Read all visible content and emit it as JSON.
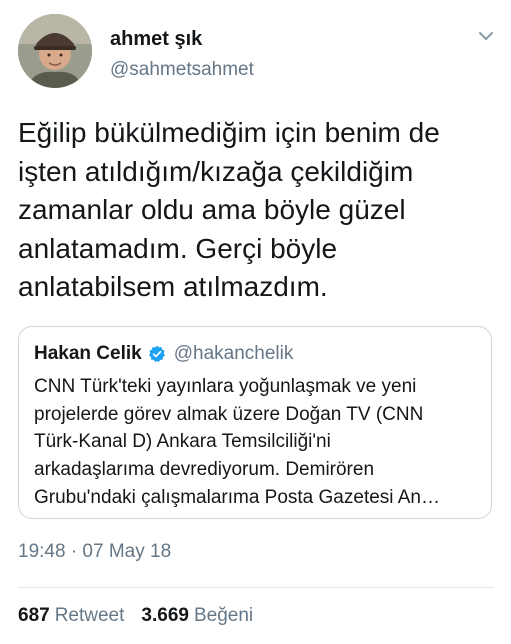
{
  "author": {
    "display_name": "ahmet şık",
    "handle": "@sahmetsahmet"
  },
  "tweet": {
    "text": "Eğilip bükülmediğim için benim de\nişten atıldığım/kızağa çekildiğim\nzamanlar oldu ama böyle güzel\nanlatamadım. Gerçi böyle\nanlatabilsem atılmazdım."
  },
  "quoted_tweet": {
    "display_name": "Hakan Celik",
    "handle": "@hakanchelik",
    "text": "CNN Türk'teki yayınlara yoğunlaşmak ve yeni\nprojelerde görev almak üzere Doğan TV (CNN\nTürk-Kanal D) Ankara Temsilciliği'ni\narkadaşlarıma devrediyorum. Demirören\nGrubu'ndaki çalışmalarıma Posta Gazetesi An…"
  },
  "timestamp": "19:48 · 07 May 18",
  "stats": {
    "retweet_count": "687",
    "retweet_label": "Retweet",
    "like_count": "3.669",
    "like_label": "Beğeni"
  },
  "colors": {
    "text_primary": "#14171a",
    "text_secondary": "#657786",
    "verified_blue": "#1da1f2",
    "border": "#ccd6dd"
  },
  "icons": {
    "verified": "verified-badge-icon",
    "menu": "chevron-down-icon"
  }
}
